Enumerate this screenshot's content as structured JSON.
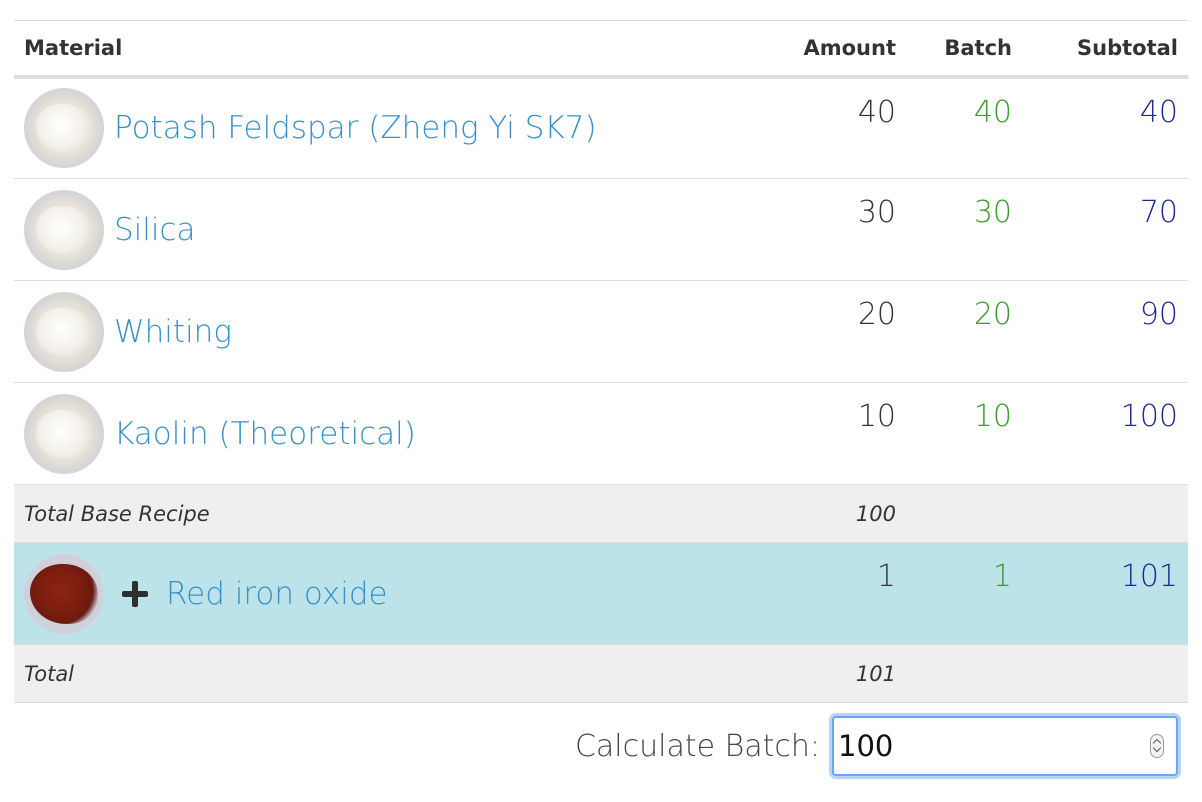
{
  "columns": {
    "material": "Material",
    "amount": "Amount",
    "batch": "Batch",
    "subtotal": "Subtotal"
  },
  "materials": [
    {
      "name": "Potash Feldspar (Zheng Yi SK7)",
      "amount": "40",
      "batch": "40",
      "subtotal": "40",
      "icon": "white-powder-thumbnail"
    },
    {
      "name": "Silica",
      "amount": "30",
      "batch": "30",
      "subtotal": "70",
      "icon": "white-powder-thumbnail"
    },
    {
      "name": "Whiting",
      "amount": "20",
      "batch": "20",
      "subtotal": "90",
      "icon": "white-powder-thumbnail"
    },
    {
      "name": "Kaolin (Theoretical)",
      "amount": "10",
      "batch": "10",
      "subtotal": "100",
      "icon": "white-powder-thumbnail"
    }
  ],
  "base_total": {
    "label": "Total Base Recipe",
    "amount": "100"
  },
  "additives": [
    {
      "name": "Red iron oxide",
      "amount": "1",
      "batch": "1",
      "subtotal": "101",
      "icon": "red-powder-thumbnail",
      "prefix_icon": "plus-icon"
    }
  ],
  "grand_total": {
    "label": "Total",
    "amount": "101"
  },
  "calculate_batch": {
    "label": "Calculate Batch:",
    "value": "100"
  },
  "colors": {
    "link": "#3790c9",
    "batch_value": "#3a9a2a",
    "subtotal_value": "#1c2b8c",
    "additive_row_bg": "#bde3ea",
    "total_row_bg": "#efefef"
  }
}
